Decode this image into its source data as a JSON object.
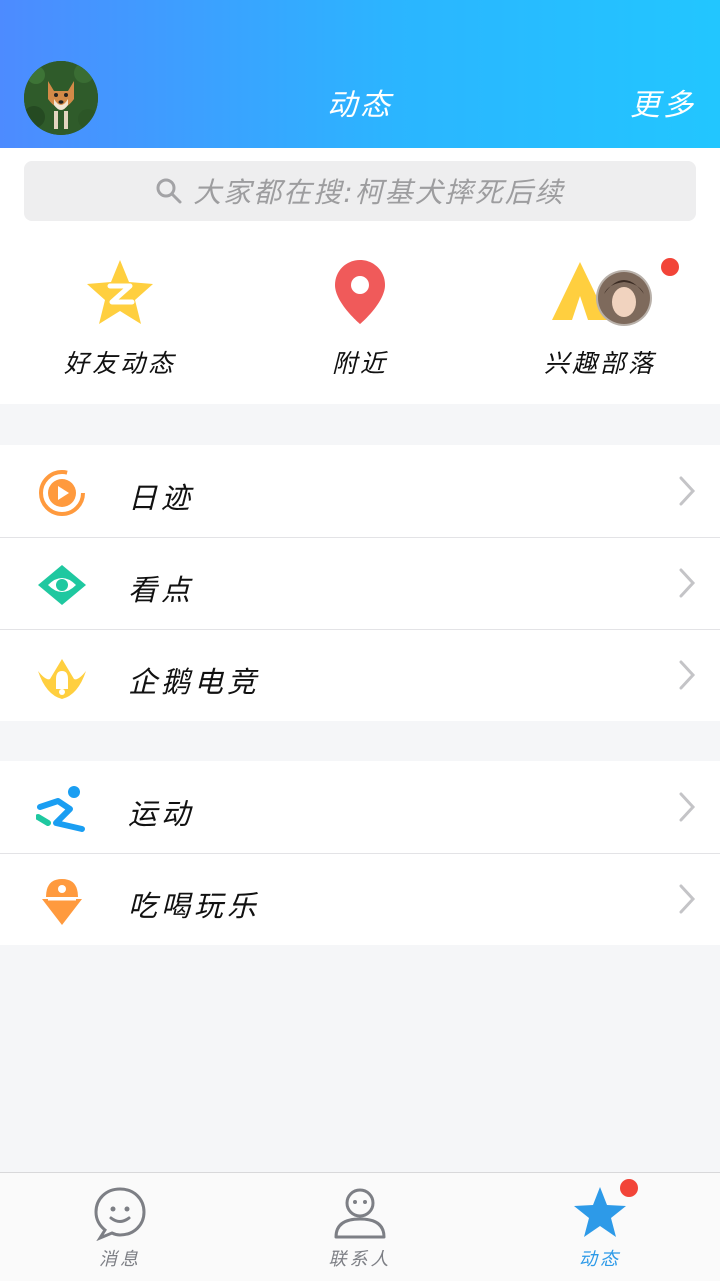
{
  "header": {
    "title": "动态",
    "more_label": "更多"
  },
  "search": {
    "placeholder": "大家都在搜:柯基犬摔死后续"
  },
  "quick_links": [
    {
      "label": "好友动态",
      "icon": "qzone-star-icon"
    },
    {
      "label": "附近",
      "icon": "location-pin-icon"
    },
    {
      "label": "兴趣部落",
      "icon": "tent-icon"
    }
  ],
  "menu_group_1": [
    {
      "label": "日迹",
      "icon": "play-circle-icon"
    },
    {
      "label": "看点",
      "icon": "eye-icon"
    },
    {
      "label": "企鹅电竞",
      "icon": "esports-crown-icon"
    }
  ],
  "menu_group_2": [
    {
      "label": "运动",
      "icon": "running-icon"
    },
    {
      "label": "吃喝玩乐",
      "icon": "ice-cream-icon"
    }
  ],
  "tabbar": [
    {
      "label": "消息",
      "icon": "chat-bubble-icon",
      "active": false
    },
    {
      "label": "联系人",
      "icon": "contact-person-icon",
      "active": false
    },
    {
      "label": "动态",
      "icon": "star-icon",
      "active": true
    }
  ],
  "colors": {
    "header_gradient_start": "#4d8bff",
    "header_gradient_end": "#22c6ff",
    "accent": "#2d9ae8",
    "badge": "#f24438",
    "yellow": "#ffcf3f",
    "pin_red": "#f05a5a",
    "teal": "#1fc8a0",
    "orange": "#ff9a3e"
  }
}
